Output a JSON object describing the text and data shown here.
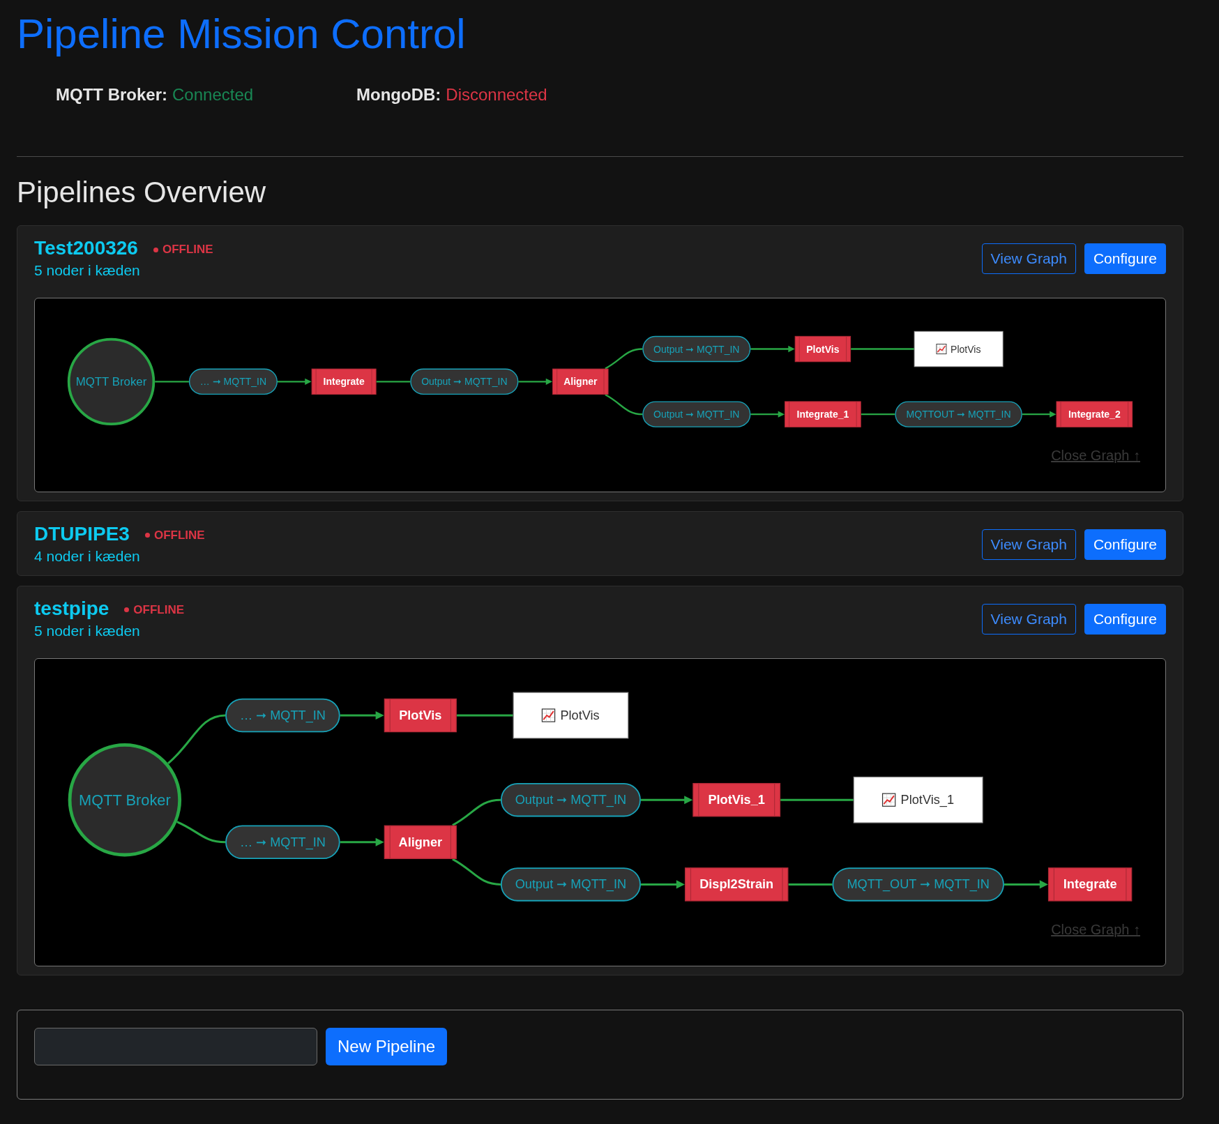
{
  "header": {
    "title": "Pipeline Mission Control",
    "services": [
      {
        "label": "MQTT Broker:",
        "value": "Connected",
        "connected": true
      },
      {
        "label": "MongoDB:",
        "value": "Disconnected",
        "connected": false
      }
    ]
  },
  "section_title": "Pipelines Overview",
  "pipelines": [
    {
      "name": "Test200326",
      "status": "OFFLINE",
      "online": false,
      "node_count": "5 noder i kæden",
      "actions": [
        {
          "label": "View Graph",
          "kind": "outline"
        },
        {
          "label": "Configure",
          "kind": "filled"
        }
      ],
      "graph": {
        "close_link": "Close Graph ↑",
        "root": {
          "kind": "broker",
          "label": "MQTT Broker",
          "children": [
            {
              "kind": "topic",
              "label": "… ➞ MQTT_IN",
              "children": [
                {
                  "kind": "processor",
                  "label": "Integrate",
                  "children": [
                    {
                      "kind": "topic",
                      "label": "Output ➞ MQTT_IN",
                      "children": [
                        {
                          "kind": "processor",
                          "label": "Aligner",
                          "children": [
                            {
                              "kind": "topic",
                              "label": "Output ➞ MQTT_IN",
                              "children": [
                                {
                                  "kind": "processor",
                                  "label": "PlotVis",
                                  "children": [
                                    {
                                      "kind": "visual",
                                      "label": "PlotVis"
                                    }
                                  ]
                                }
                              ]
                            },
                            {
                              "kind": "topic",
                              "label": "Output ➞ MQTT_IN",
                              "children": [
                                {
                                  "kind": "processor",
                                  "label": "Integrate_1",
                                  "children": [
                                    {
                                      "kind": "topic",
                                      "label": "MQTTOUT ➞ MQTT_IN",
                                      "children": [
                                        {
                                          "kind": "processor",
                                          "label": "Integrate_2"
                                        }
                                      ]
                                    }
                                  ]
                                }
                              ]
                            }
                          ]
                        }
                      ]
                    }
                  ]
                }
              ]
            }
          ]
        }
      }
    },
    {
      "name": "DTUPIPE3",
      "status": "OFFLINE",
      "online": false,
      "node_count": "4 noder i kæden",
      "actions": [
        {
          "label": "View Graph",
          "kind": "outline"
        },
        {
          "label": "Configure",
          "kind": "filled"
        }
      ]
    },
    {
      "name": "testpipe",
      "status": "OFFLINE",
      "online": false,
      "node_count": "5 noder i kæden",
      "actions": [
        {
          "label": "View Graph",
          "kind": "outline"
        },
        {
          "label": "Configure",
          "kind": "filled"
        }
      ],
      "graph": {
        "close_link": "Close Graph ↑",
        "root": {
          "kind": "broker",
          "label": "MQTT Broker",
          "children": [
            {
              "kind": "topic",
              "label": "… ➞ MQTT_IN",
              "children": [
                {
                  "kind": "processor",
                  "label": "PlotVis",
                  "children": [
                    {
                      "kind": "visual",
                      "label": "PlotVis"
                    }
                  ]
                }
              ]
            },
            {
              "kind": "topic",
              "label": "… ➞ MQTT_IN",
              "children": [
                {
                  "kind": "processor",
                  "label": "Aligner",
                  "children": [
                    {
                      "kind": "topic",
                      "label": "Output ➞ MQTT_IN",
                      "children": [
                        {
                          "kind": "processor",
                          "label": "PlotVis_1",
                          "children": [
                            {
                              "kind": "visual",
                              "label": "PlotVis_1"
                            }
                          ]
                        }
                      ]
                    },
                    {
                      "kind": "topic",
                      "label": "Output ➞ MQTT_IN",
                      "children": [
                        {
                          "kind": "processor",
                          "label": "Displ2Strain",
                          "children": [
                            {
                              "kind": "topic",
                              "label": "MQTT_OUT ➞ MQTT_IN",
                              "children": [
                                {
                                  "kind": "processor",
                                  "label": "Integrate"
                                }
                              ]
                            }
                          ]
                        }
                      ]
                    }
                  ]
                }
              ]
            }
          ]
        }
      }
    }
  ],
  "new_pipeline": {
    "button": "New Pipeline"
  }
}
